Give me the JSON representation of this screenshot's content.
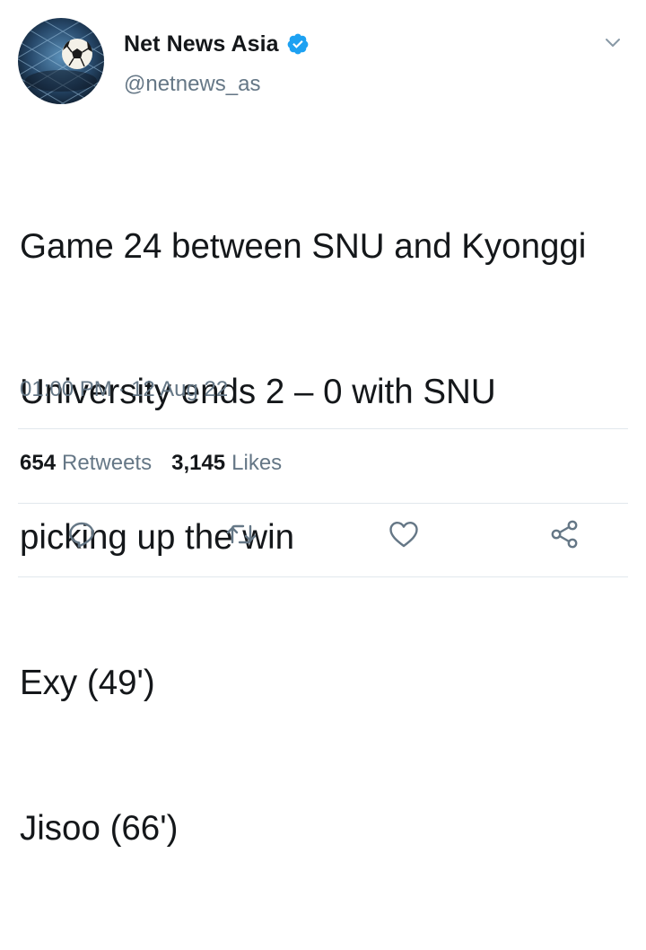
{
  "account": {
    "display_name": "Net News Asia",
    "handle": "@netnews_as",
    "verified": true,
    "avatar": "soccer-ball-in-net-icon"
  },
  "tweet": {
    "lines": [
      "Game 24 between SNU and Kyonggi",
      "University ends 2 – 0 with SNU",
      "picking up the win",
      "Exy (49')",
      "Jisoo (66')"
    ],
    "time": "01:00 PM",
    "separator": "·",
    "date": "12 Aug 22"
  },
  "stats": {
    "retweets_count": "654",
    "retweets_label": "Retweets",
    "likes_count": "3,145",
    "likes_label": "Likes"
  },
  "actions": {
    "reply": "reply-icon",
    "retweet": "retweet-icon",
    "like": "heart-icon",
    "share": "share-icon"
  },
  "colors": {
    "text": "#14171a",
    "secondary": "#657786",
    "verified": "#1da1f2",
    "divider": "#e1e8ed"
  }
}
